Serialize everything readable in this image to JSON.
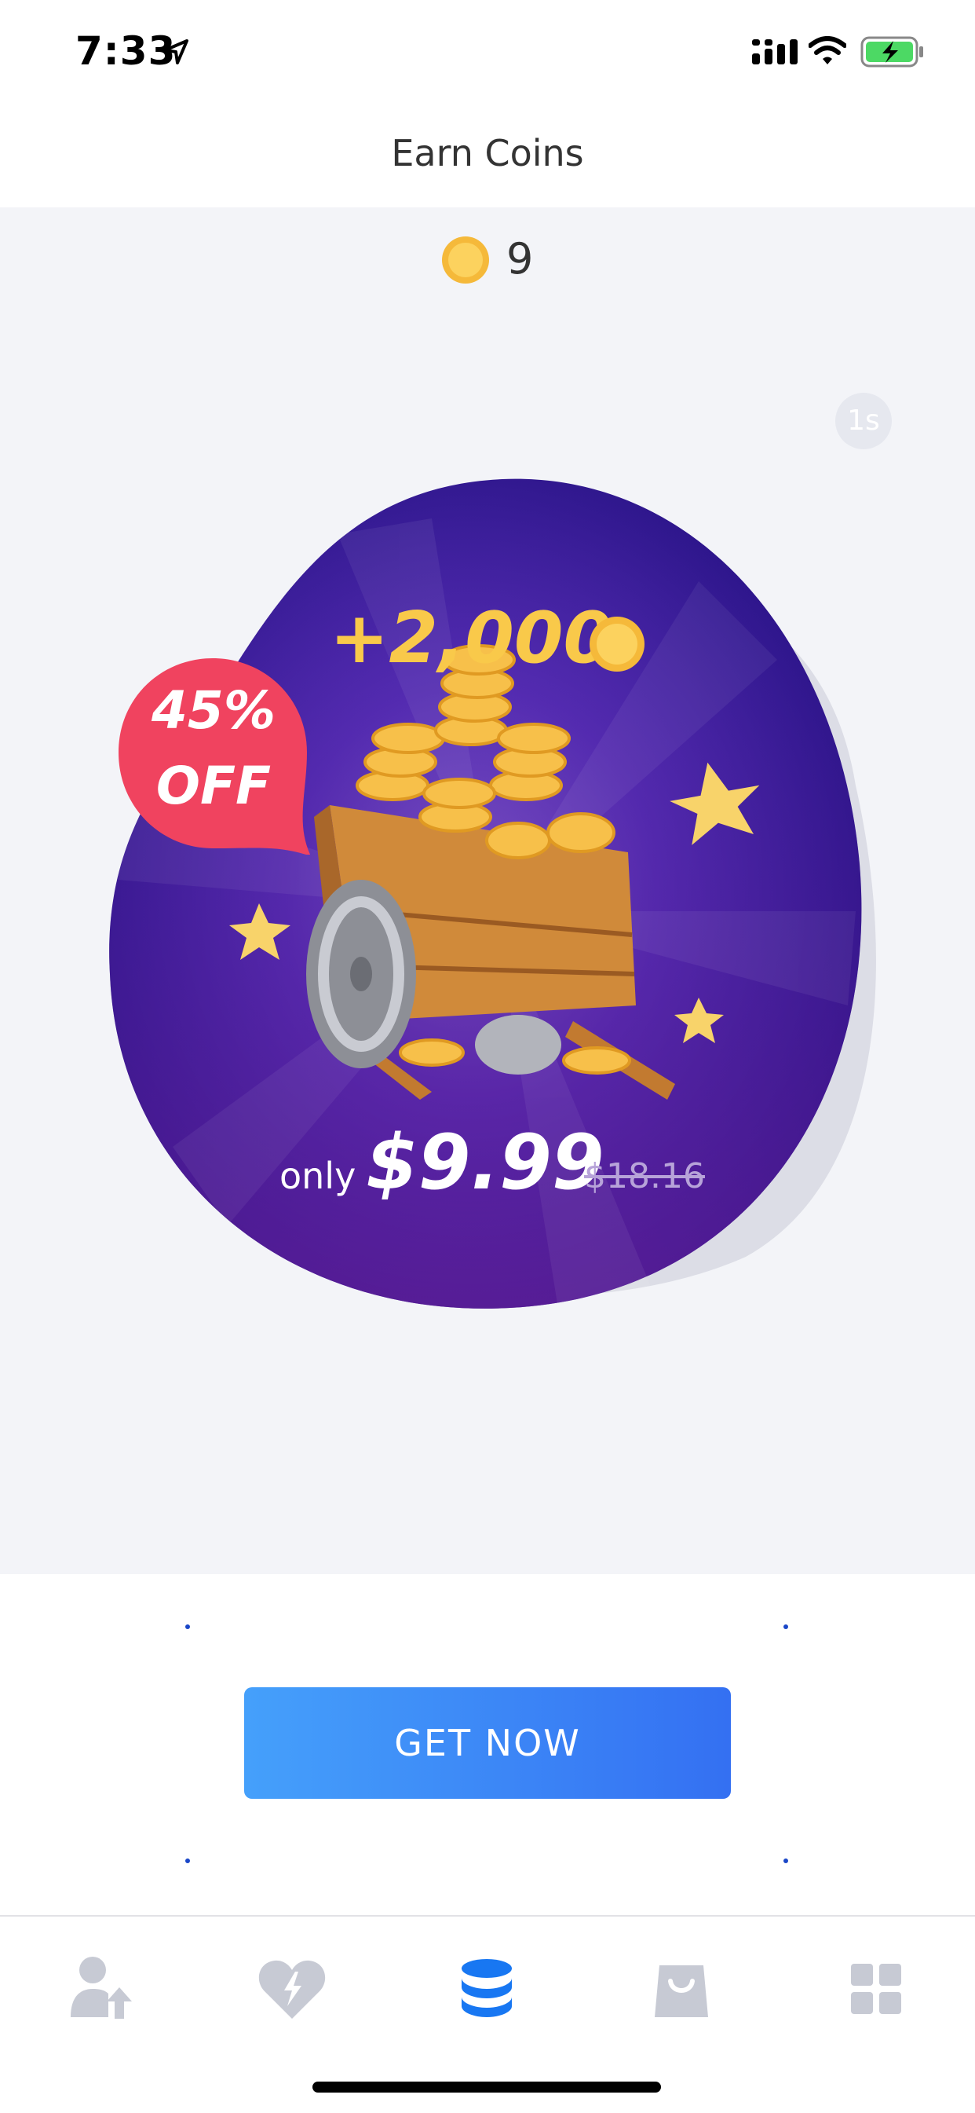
{
  "status_bar": {
    "time": "7:33",
    "icons": [
      "location-arrow-icon",
      "signal-icon",
      "wifi-icon",
      "battery-charging-icon"
    ],
    "battery_color": "#4cd964"
  },
  "header": {
    "title": "Earn Coins"
  },
  "balance": {
    "value": "9",
    "icon": "coin-icon"
  },
  "timer": {
    "label": "1s"
  },
  "offer": {
    "amount": "+2,000",
    "badge_line1": "45%",
    "badge_line2": "OFF",
    "price_prefix": "only",
    "price": "$9.99",
    "original_price": "$18.16",
    "illustration": "coin-cart-illustration",
    "colors": {
      "blob_dark": "#2a1488",
      "blob_mid": "#6a3fbf",
      "badge": "#f0435f",
      "coin": "#f9c94a"
    }
  },
  "cta": {
    "label": "GET NOW",
    "gradient": [
      "#45a0fb",
      "#3470f2"
    ]
  },
  "tabbar": {
    "tabs": [
      {
        "name": "profile-tab",
        "icon": "person-up-icon",
        "active": false
      },
      {
        "name": "favorites-tab",
        "icon": "heart-bolt-icon",
        "active": false
      },
      {
        "name": "coins-tab",
        "icon": "coin-stack-icon",
        "active": true
      },
      {
        "name": "shop-tab",
        "icon": "bag-icon",
        "active": false
      },
      {
        "name": "more-tab",
        "icon": "grid-icon",
        "active": false
      }
    ],
    "active_color": "#1877f2",
    "inactive_color": "#c7cad4"
  }
}
